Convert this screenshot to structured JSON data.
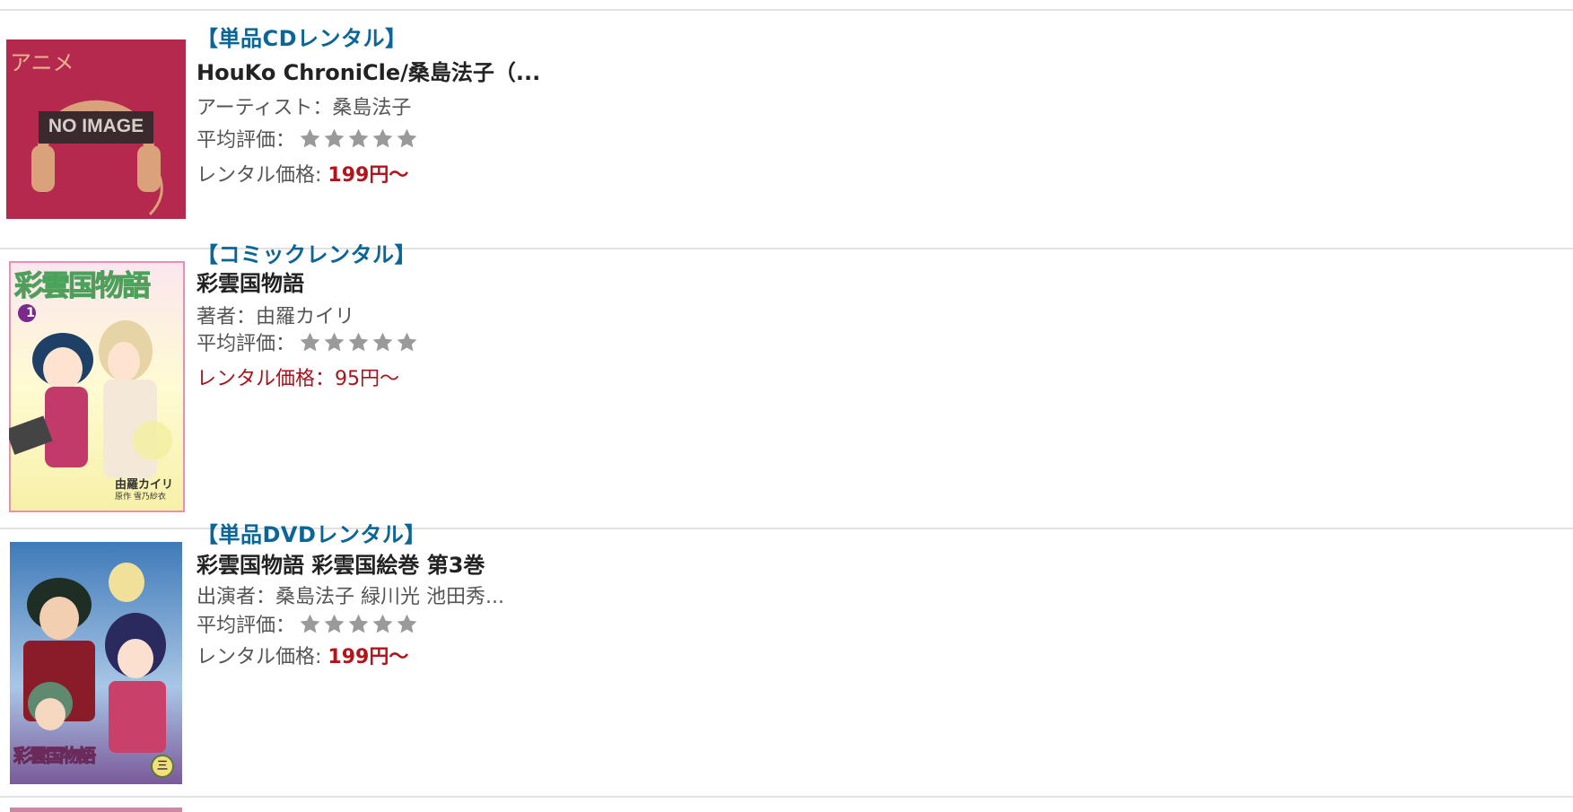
{
  "items": [
    {
      "category": "【単品CDレンタル】",
      "title": "HouKo ChroniCle/桑島法子（...",
      "credit": "アーティスト：桑島法子",
      "rating_label": "平均評価：",
      "rating": 0,
      "price_label": "レンタル価格: ",
      "price_value": "199円〜",
      "thumb": {
        "label": "アニメ",
        "badge": "NO IMAGE",
        "bg_color": "#b5294f",
        "art_color": "#d9a27a"
      }
    },
    {
      "category": "【コミックレンタル】",
      "title": "彩雲国物語",
      "credit": "著者：由羅カイリ",
      "rating_label": "平均評価：",
      "rating": 0,
      "price_label": "レンタル価格：",
      "price_value": "95円〜",
      "thumb": {
        "cover_title": "彩雲国物語",
        "volume": "1",
        "author": "由羅カイリ",
        "subcredit": "原作 雪乃紗衣"
      }
    },
    {
      "category": "【単品DVDレンタル】",
      "title": "彩雲国物語 彩雲国絵巻 第3巻",
      "credit": "出演者：桑島法子 緑川光 池田秀...",
      "rating_label": "平均評価：",
      "rating": 0,
      "price_label": "レンタル価格: ",
      "price_value": "199円〜",
      "thumb": {
        "cover_title": "彩雲国物語",
        "disc_mark": "三"
      }
    }
  ],
  "colors": {
    "category": "#0b6597",
    "price": "#b3141c",
    "star_empty": "#9a9a9a",
    "divider": "#e2e2e2"
  }
}
